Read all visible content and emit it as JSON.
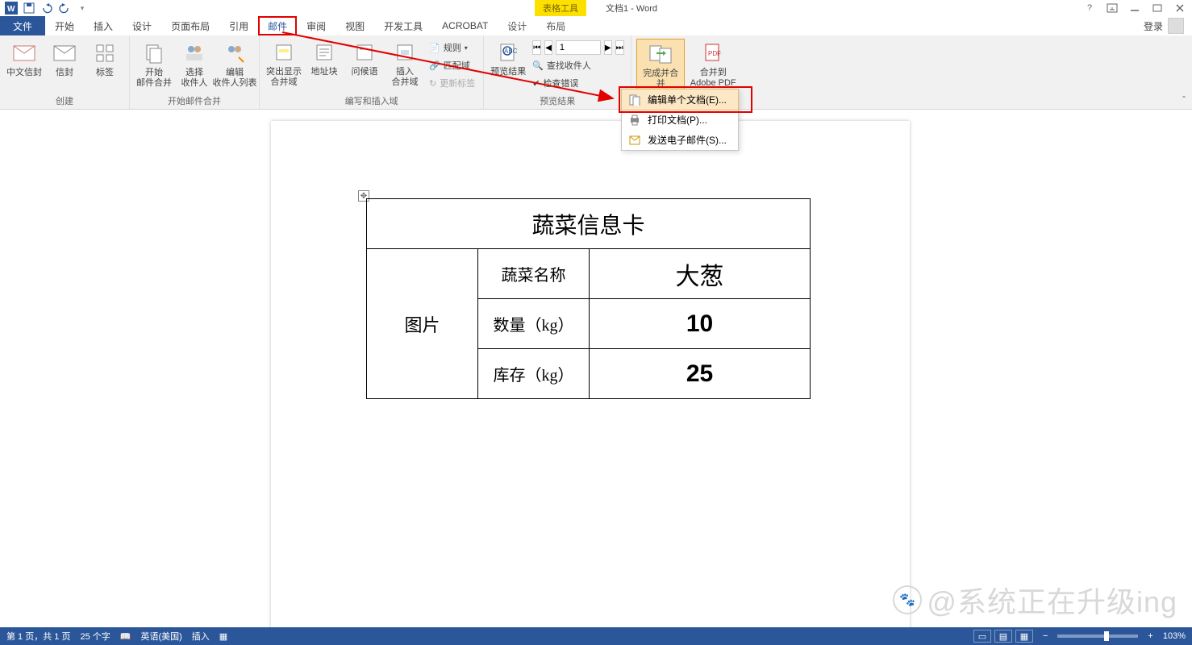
{
  "title": {
    "tools_tab": "表格工具",
    "doc": "文档1 - Word"
  },
  "window": {
    "login": "登录"
  },
  "tabs": {
    "file": "文件",
    "home": "开始",
    "insert": "插入",
    "design": "设计",
    "layout": "页面布局",
    "references": "引用",
    "mailings": "邮件",
    "review": "审阅",
    "view": "视图",
    "developer": "开发工具",
    "acrobat": "ACROBAT",
    "ctx_design": "设计",
    "ctx_layout": "布局"
  },
  "ribbon": {
    "groups": {
      "create": "创建",
      "start_merge": "开始邮件合并",
      "write_insert": "编写和插入域",
      "preview": "预览结果"
    },
    "create_btns": {
      "cn_envelope": "中文信封",
      "envelope": "信封",
      "labels": "标签"
    },
    "start_btns": {
      "start": "开始\n邮件合并",
      "select": "选择\n收件人",
      "edit": "编辑\n收件人列表"
    },
    "write_btns": {
      "highlight": "突出显示\n合并域",
      "address": "地址块",
      "greeting": "问候语",
      "insert": "插入\n合并域",
      "rules": "规则",
      "match": "匹配域",
      "update": "更新标签"
    },
    "preview_btns": {
      "preview": "预览结果",
      "find": "查找收件人",
      "check": "检查错误",
      "record": "1"
    },
    "finish": {
      "finish": "完成并合并",
      "pdf": "合并到\nAdobe PDF"
    }
  },
  "dropdown": {
    "edit": "编辑单个文档(E)...",
    "print": "打印文档(P)...",
    "email": "发送电子邮件(S)..."
  },
  "table": {
    "title": "蔬菜信息卡",
    "img": "图片",
    "r1_label": "蔬菜名称",
    "r1_val": "大葱",
    "r2_label": "数量（kg）",
    "r2_val": "10",
    "r3_label": "库存（kg）",
    "r3_val": "25"
  },
  "status": {
    "page": "第 1 页，共 1 页",
    "words": "25 个字",
    "lang": "英语(美国)",
    "insert": "插入",
    "zoom": "103%"
  },
  "watermark": "@系统正在升级ing"
}
